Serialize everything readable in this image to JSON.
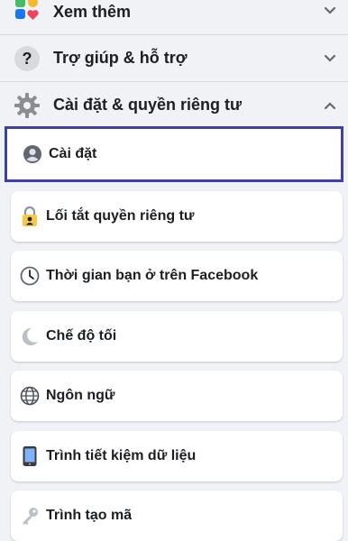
{
  "sections": [
    {
      "label": "Xem thêm",
      "icon": "grid-shapes-icon",
      "chevron": "down"
    },
    {
      "label": "Trợ giúp & hỗ trợ",
      "icon": "question-circle-icon",
      "chevron": "down"
    },
    {
      "label": "Cài đặt & quyền riêng tư",
      "icon": "gear-icon",
      "chevron": "up"
    }
  ],
  "settings_items": [
    {
      "label": "Cài đặt",
      "icon": "profile-circle-icon",
      "selected": true
    },
    {
      "label": "Lối tắt quyền riêng tư",
      "icon": "lock-person-icon"
    },
    {
      "label": "Thời gian bạn ở trên Facebook",
      "icon": "clock-icon"
    },
    {
      "label": "Chế độ tối",
      "icon": "moon-icon"
    },
    {
      "label": "Ngôn ngữ",
      "icon": "globe-icon"
    },
    {
      "label": "Trình tiết kiệm dữ liệu",
      "icon": "phone-icon"
    },
    {
      "label": "Trình tạo mã",
      "icon": "key-icon"
    }
  ],
  "colors": {
    "background": "#f0f2f5",
    "card": "#ffffff",
    "selection_border": "#3f3fa8"
  }
}
